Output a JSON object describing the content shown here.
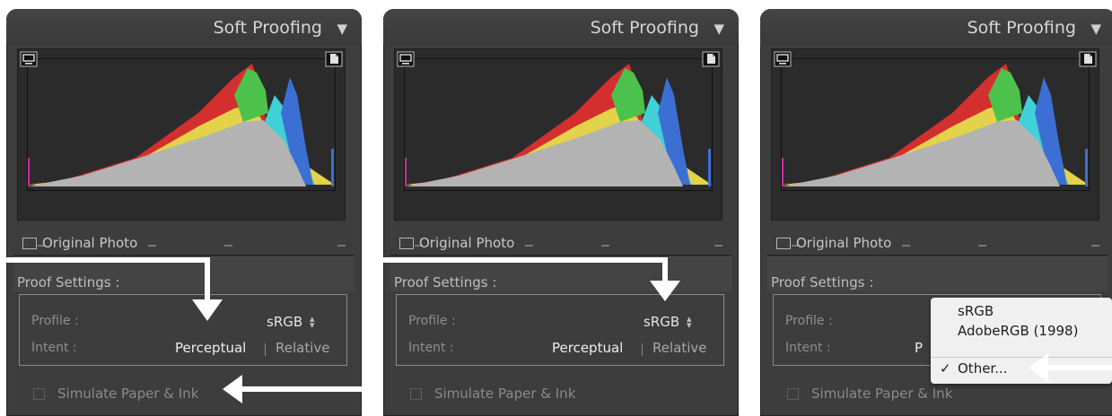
{
  "panels": [
    {
      "title": "Soft Proofing",
      "original_photo_label": "Original Photo",
      "proof_settings_label": "Proof Settings :",
      "profile_label": "Profile :",
      "profile_value": "sRGB",
      "intent_label": "Intent :",
      "intent_perceptual": "Perceptual",
      "intent_relative": "Relative",
      "simulate_label": "Simulate Paper & Ink"
    },
    {
      "title": "Soft Proofing",
      "original_photo_label": "Original Photo",
      "proof_settings_label": "Proof Settings :",
      "profile_label": "Profile :",
      "profile_value": "sRGB",
      "intent_label": "Intent :",
      "intent_perceptual": "Perceptual",
      "intent_relative": "Relative",
      "simulate_label": "Simulate Paper & Ink"
    },
    {
      "title": "Soft Proofing",
      "original_photo_label": "Original Photo",
      "proof_settings_label": "Proof Settings :",
      "profile_label": "Profile :",
      "profile_value": "",
      "intent_label": "Intent :",
      "intent_perceptual": "P",
      "intent_relative": "",
      "simulate_label": "Simulate Paper & Ink"
    }
  ],
  "dropdown": {
    "options": [
      "sRGB",
      "AdobeRGB (1998)"
    ],
    "selected": "Other...",
    "check": "✓"
  },
  "icons": {
    "collapse": "triangle-down-icon",
    "monitor": "monitor-icon",
    "document": "document-icon",
    "arrows": "white-callout-arrow-icon"
  },
  "colors": {
    "panel_bg": "#3d3d3d",
    "histogram_gray": "#b3b3b3",
    "red": "#d42f2f",
    "yellow": "#e3d34a",
    "green": "#4cc24c",
    "cyan": "#3fd0d8",
    "blue": "#3c6fd4",
    "magenta": "#cc2ea0"
  }
}
